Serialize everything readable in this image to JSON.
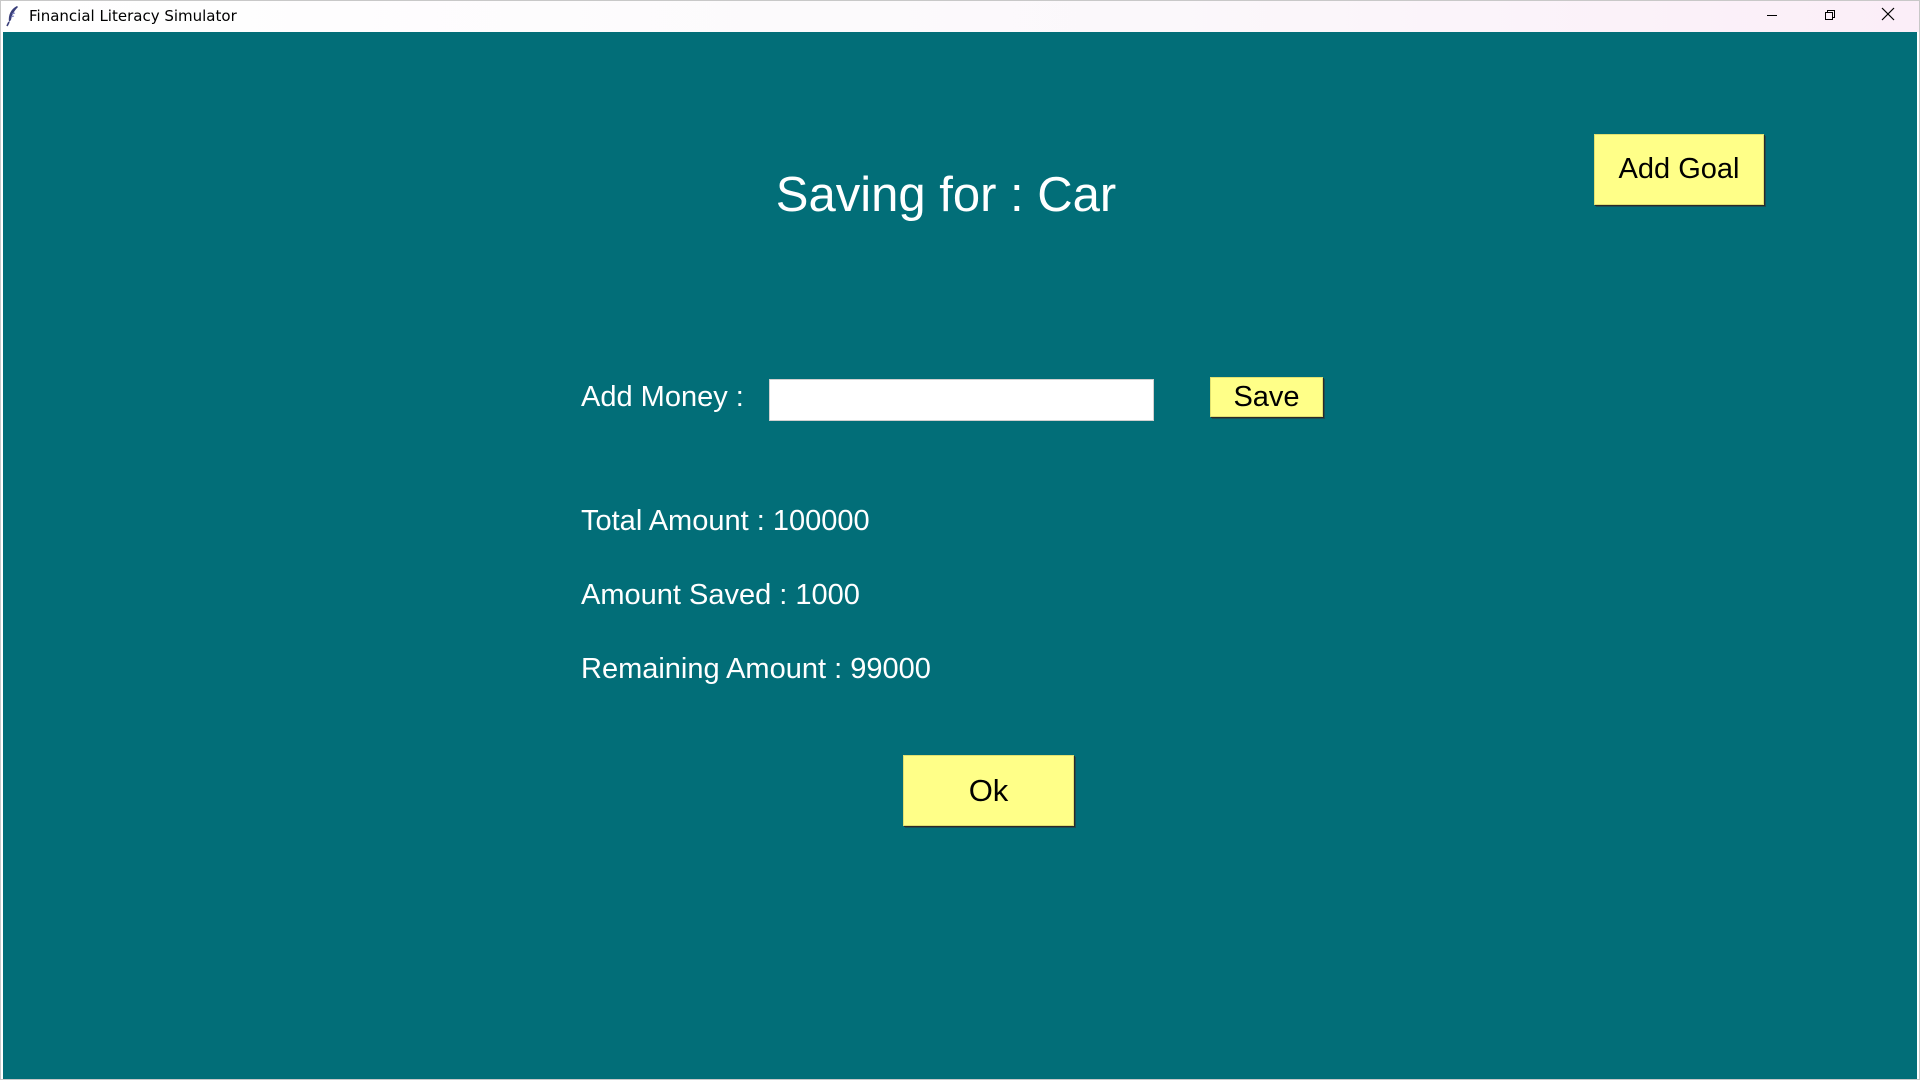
{
  "window": {
    "title": "Financial Literacy Simulator",
    "icons": {
      "app": "feather-icon",
      "minimize": "minimize-icon",
      "restore": "restore-icon",
      "close": "close-icon"
    }
  },
  "colors": {
    "background": "#026e78",
    "button": "#ffff88",
    "text": "#ffffff"
  },
  "heading": "Saving for : Car",
  "buttons": {
    "add_goal": "Add Goal",
    "save": "Save",
    "ok": "Ok"
  },
  "add_money": {
    "label": "Add Money :",
    "value": "",
    "placeholder": ""
  },
  "summary": {
    "total": "Total Amount : 100000",
    "saved": "Amount Saved : 1000",
    "remaining": "Remaining Amount : 99000"
  }
}
